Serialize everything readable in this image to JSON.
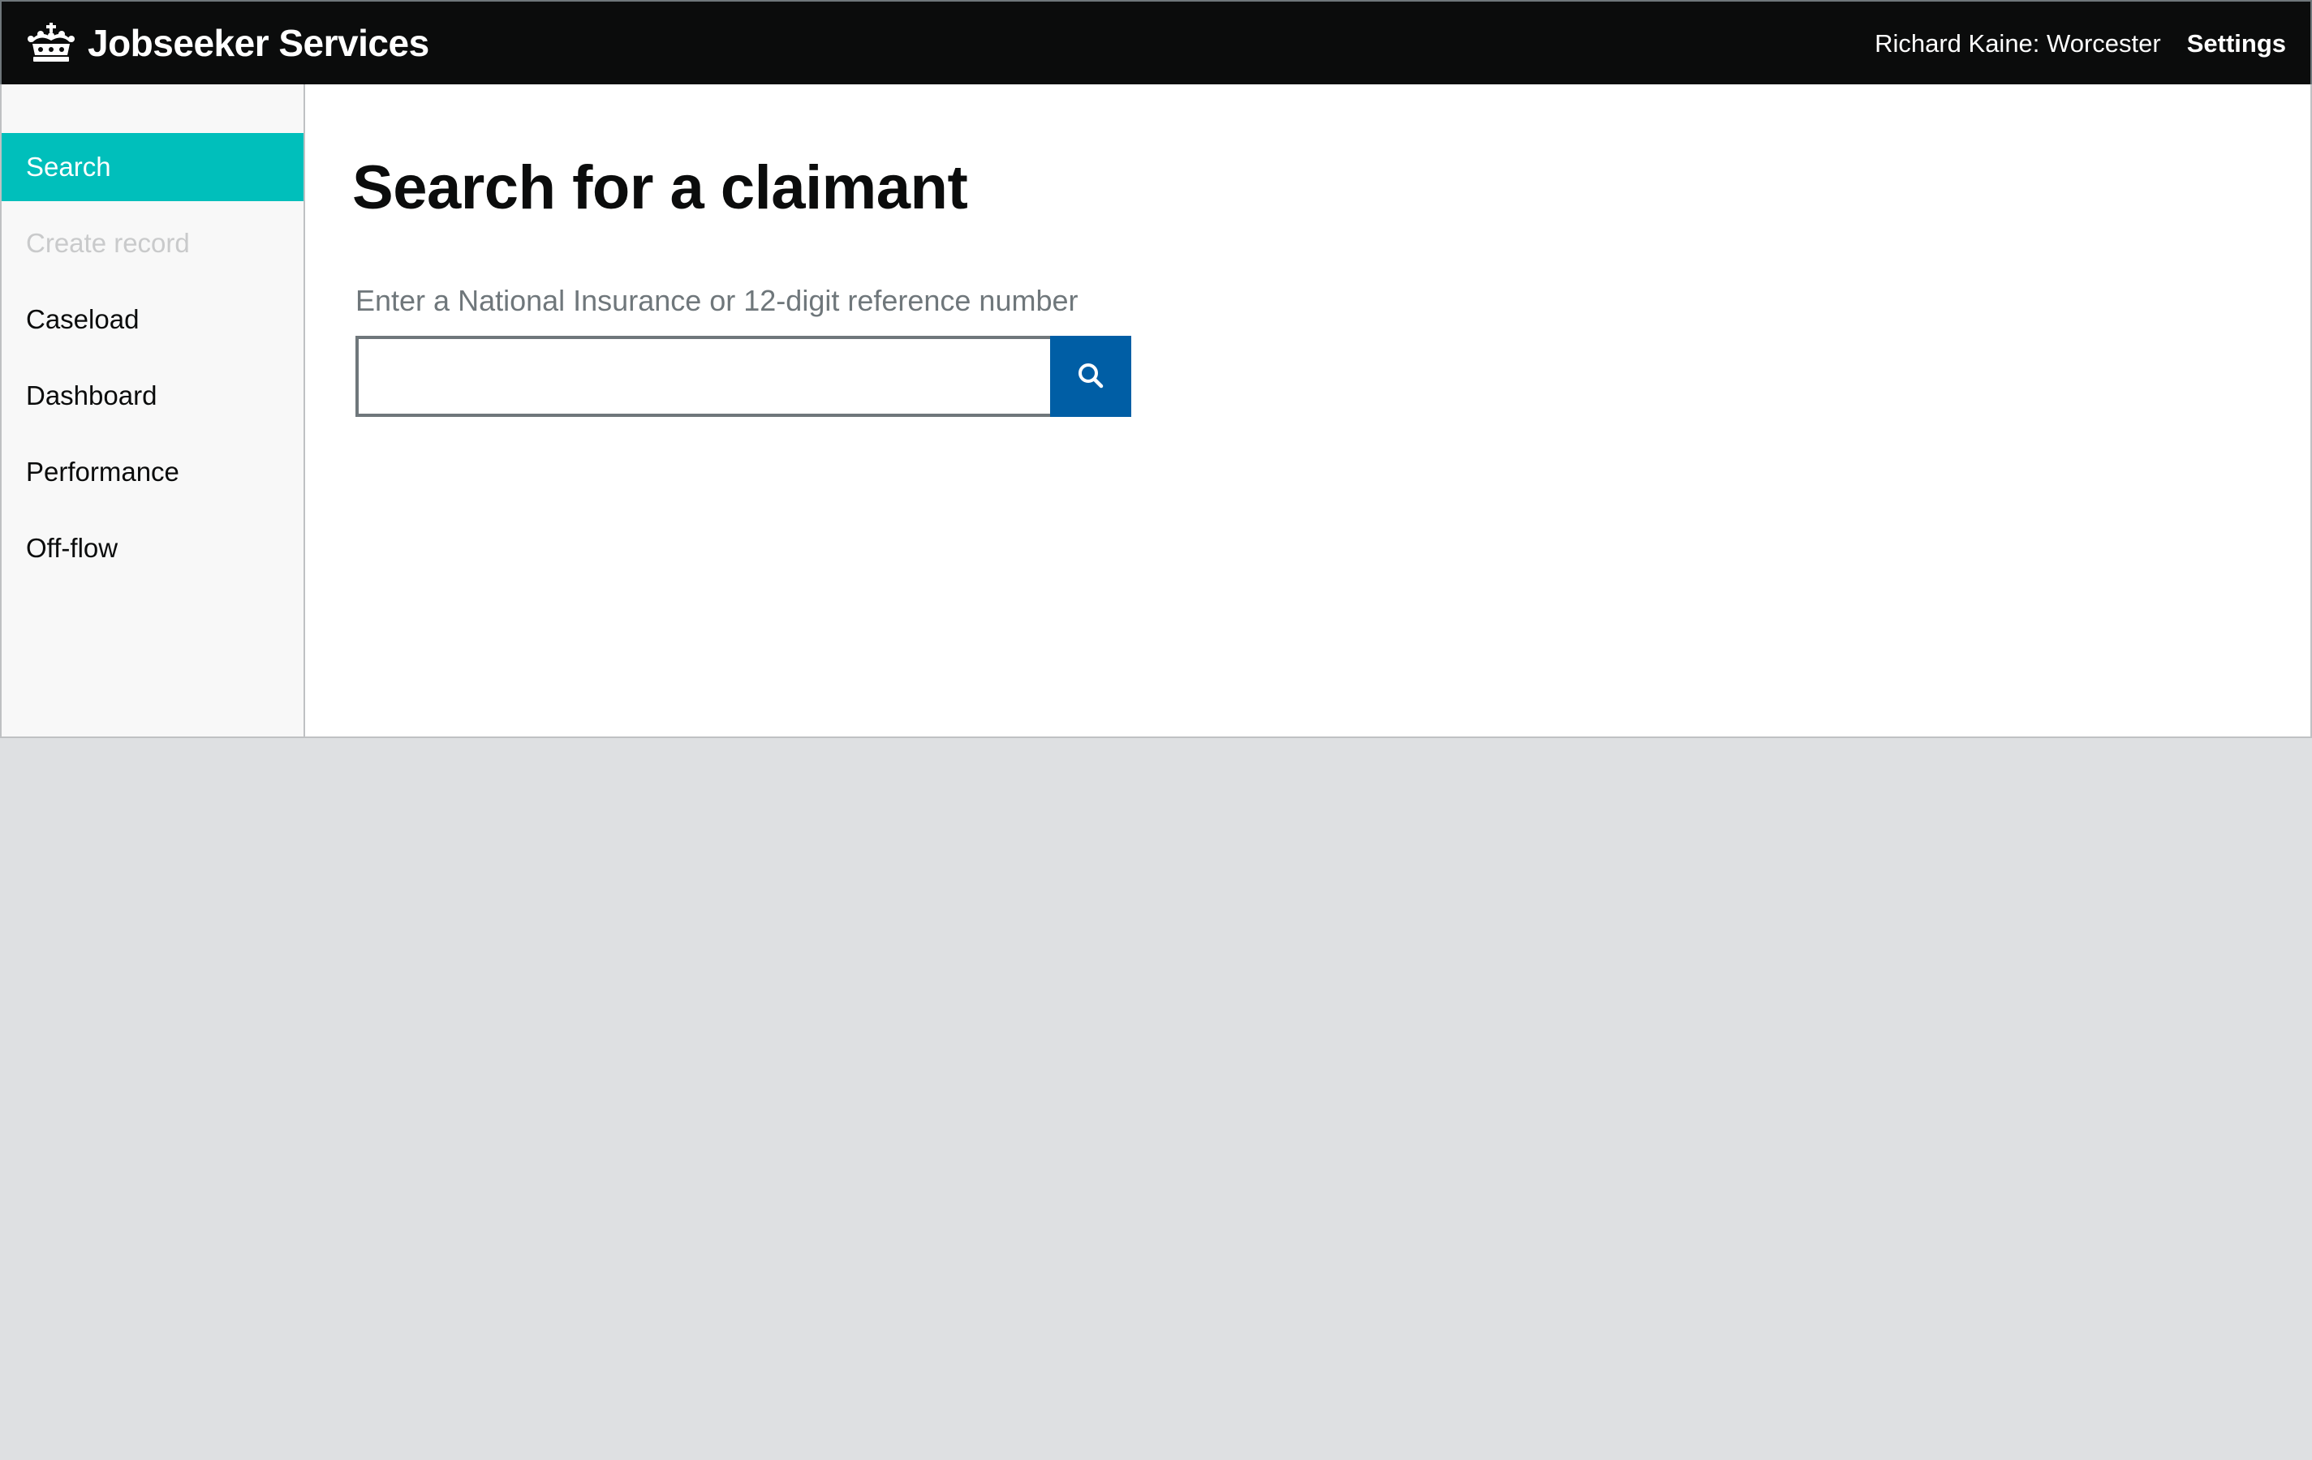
{
  "header": {
    "brand_title": "Jobseeker Services",
    "brand_icon": "crown-icon",
    "user_info": "Richard Kaine: Worcester",
    "settings_label": "Settings"
  },
  "sidebar": {
    "items": [
      {
        "label": "Search",
        "state": "active"
      },
      {
        "label": "Create record",
        "state": "disabled"
      },
      {
        "label": "Caseload",
        "state": "normal"
      },
      {
        "label": "Dashboard",
        "state": "normal"
      },
      {
        "label": "Performance",
        "state": "normal"
      },
      {
        "label": "Off-flow",
        "state": "normal"
      }
    ]
  },
  "main": {
    "title": "Search for a claimant",
    "search": {
      "label": "Enter a National Insurance or 12-digit reference number",
      "value": "",
      "placeholder": "",
      "button_icon": "search-icon"
    }
  },
  "colors": {
    "header_bg": "#0b0c0c",
    "active_nav": "#00bfbb",
    "search_button": "#005ea5",
    "page_bg": "#dee0e2",
    "sidebar_bg": "#f8f8f8"
  }
}
